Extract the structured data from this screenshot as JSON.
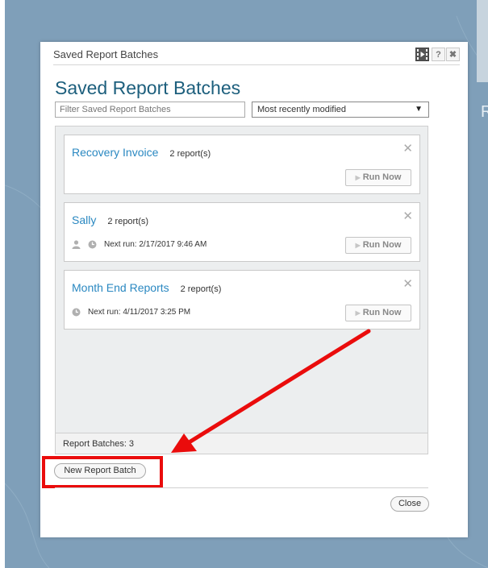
{
  "dialog": {
    "window_title": "Saved Report Batches",
    "heading": "Saved Report Batches",
    "help_label": "?",
    "close_x_label": "✖",
    "filter": {
      "placeholder": "Filter Saved Report Batches",
      "value": ""
    },
    "sort": {
      "selected": "Most recently modified",
      "arrow": "▼"
    },
    "batches": [
      {
        "name": "Recovery Invoice",
        "count": "2 report(s)",
        "next_run": "",
        "run_label": "Run Now"
      },
      {
        "name": "Sally",
        "count": "2 report(s)",
        "next_run": "Next run: 2/17/2017 9:46 AM",
        "run_label": "Run Now"
      },
      {
        "name": "Month End Reports",
        "count": "2 report(s)",
        "next_run": "Next run: 4/11/2017 3:25 PM",
        "run_label": "Run Now"
      }
    ],
    "remove_label": "✕",
    "batch_count_text": "Report Batches: 3",
    "new_batch_label": "New Report Batch",
    "close_label": "Close"
  },
  "background": {
    "partial_letter": "R"
  },
  "colors": {
    "annotation": "#ea0c0c",
    "link": "#2a88c1",
    "heading": "#1d5f7d"
  }
}
